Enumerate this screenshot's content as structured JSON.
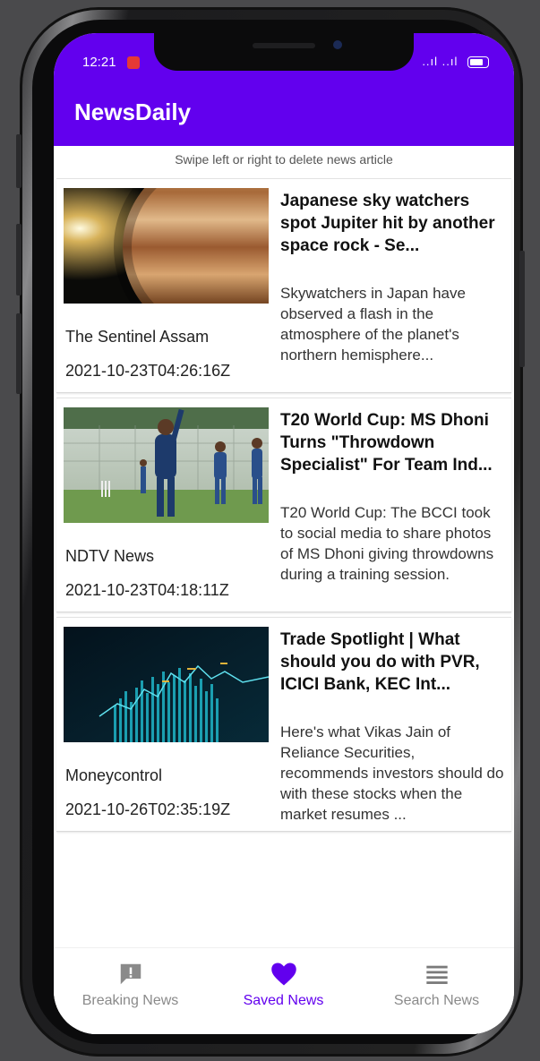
{
  "status_bar": {
    "time": "12:21",
    "signal": "..ıl ..ıl"
  },
  "app_bar": {
    "title": "NewsDaily"
  },
  "hint": "Swipe left or right to delete news article",
  "articles": [
    {
      "headline": "Japanese sky watchers spot Jupiter hit by another space rock - Se...",
      "description": "Skywatchers in Japan have observed a flash in the atmosphere of the planet's northern hemisphere...",
      "source": "The Sentinel Assam",
      "date": "2021-10-23T04:26:16Z",
      "image_icon": "jupiter-image"
    },
    {
      "headline": "T20 World Cup: MS Dhoni Turns \"Throwdown Specialist\" For Team Ind...",
      "description": "T20 World Cup: The BCCI took to social media to share photos of MS Dhoni giving throwdowns during a training session.",
      "source": "NDTV News",
      "date": "2021-10-23T04:18:11Z",
      "image_icon": "cricket-training-image"
    },
    {
      "headline": "Trade Spotlight | What should you do with PVR, ICICI Bank, KEC Int...",
      "description": "Here's what Vikas Jain of Reliance Securities, recommends investors should do with these stocks when the market resumes ...",
      "source": "Moneycontrol",
      "date": "2021-10-26T02:35:19Z",
      "image_icon": "stock-chart-image"
    }
  ],
  "bottom_nav": [
    {
      "label": "Breaking News",
      "icon": "alert-message-icon",
      "active": false
    },
    {
      "label": "Saved News",
      "icon": "heart-icon",
      "active": true
    },
    {
      "label": "Search News",
      "icon": "list-icon",
      "active": false
    }
  ],
  "colors": {
    "primary": "#6200ee",
    "inactive": "#8a8a8a",
    "background": "#ffffff"
  }
}
